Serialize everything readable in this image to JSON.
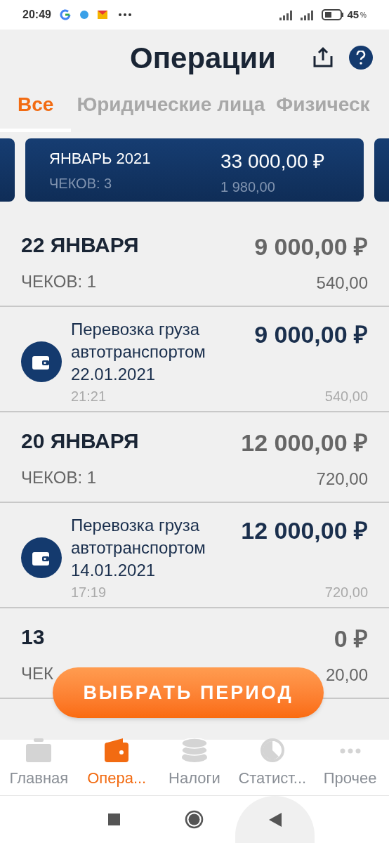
{
  "status_bar": {
    "time": "20:49",
    "battery": "45",
    "battery_unit": "%"
  },
  "header": {
    "title": "Операции"
  },
  "tabs": [
    {
      "label": "Все",
      "selected": true
    },
    {
      "label": "Юридические лица",
      "selected": false
    },
    {
      "label": "Физическ",
      "selected": false
    }
  ],
  "period_card": {
    "month": "ЯНВАРЬ 2021",
    "checks": "ЧЕКОВ: 3",
    "amount": "33 000,00 ₽",
    "tax": "1 980,00"
  },
  "groups": [
    {
      "date": "22 ЯНВАРЯ",
      "checks": "ЧЕКОВ: 1",
      "amount": "9 000,00 ₽",
      "tax": "540,00",
      "items": [
        {
          "title": "Перевозка груза автотранспортом 22.01.2021",
          "time": "21:21",
          "amount": "9 000,00 ₽",
          "tax": "540,00"
        }
      ]
    },
    {
      "date": "20 ЯНВАРЯ",
      "checks": "ЧЕКОВ: 1",
      "amount": "12 000,00 ₽",
      "tax": "720,00",
      "items": [
        {
          "title": "Перевозка груза автотранспортом 14.01.2021",
          "time": "17:19",
          "amount": "12 000,00 ₽",
          "tax": "720,00"
        }
      ]
    },
    {
      "date": "13",
      "checks": "ЧЕК",
      "amount": "0 ₽",
      "tax": "20,00"
    }
  ],
  "period_button": "ВЫБРАТЬ ПЕРИОД",
  "nav": [
    {
      "label": "Главная",
      "kind": "briefcase",
      "selected": false
    },
    {
      "label": "Опера...",
      "kind": "wallet",
      "selected": true
    },
    {
      "label": "Налоги",
      "kind": "coins",
      "selected": false
    },
    {
      "label": "Статист...",
      "kind": "chart",
      "selected": false
    },
    {
      "label": "Прочее",
      "kind": "more",
      "selected": false
    }
  ]
}
